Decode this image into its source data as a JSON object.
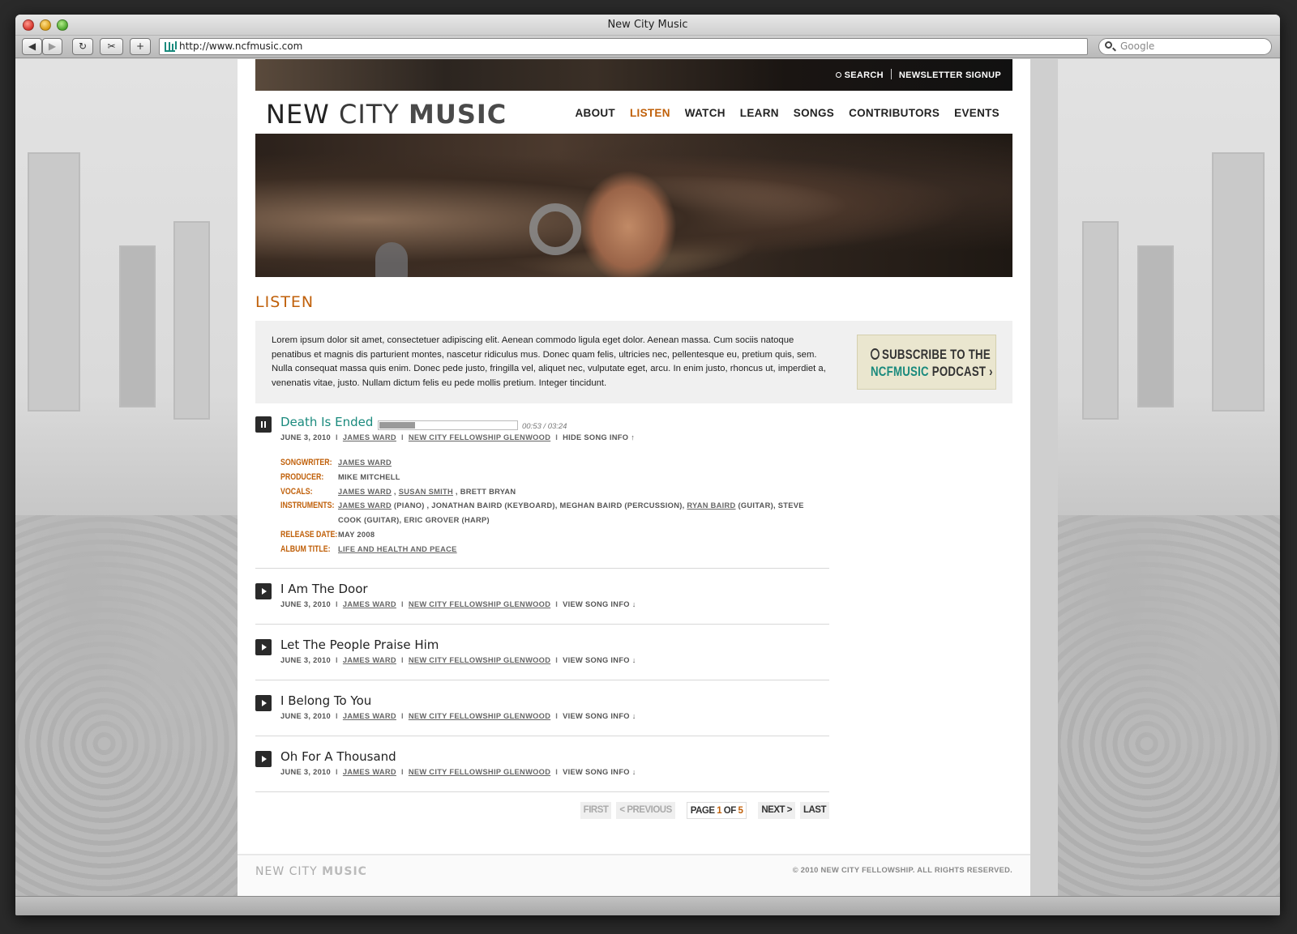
{
  "browser": {
    "window_title": "New City Music",
    "url": "http://www.ncfmusic.com",
    "search_placeholder": "Google",
    "back_icon": "◀",
    "forward_icon": "▶",
    "reload_icon": "↻",
    "add_icon": "+"
  },
  "top_links": {
    "search": "SEARCH",
    "newsletter": "NEWSLETTER SIGNUP"
  },
  "logo": {
    "part1": "NEW ",
    "part2": "CITY ",
    "part3": "MUSIC"
  },
  "nav": [
    "ABOUT",
    "LISTEN",
    "WATCH",
    "LEARN",
    "SONGS",
    "CONTRIBUTORS",
    "EVENTS"
  ],
  "nav_active": "LISTEN",
  "section_title": "LISTEN",
  "intro_text": "Lorem ipsum dolor sit amet, consectetuer adipiscing elit. Aenean commodo ligula eget dolor. Aenean massa. Cum sociis natoque penatibus et magnis dis parturient montes, nascetur ridiculus mus. Donec quam felis, ultricies nec, pellentesque eu, pretium quis, sem. Nulla consequat massa quis enim. Donec pede justo, fringilla vel, aliquet nec, vulputate eget, arcu. In enim justo, rhoncus ut, imperdiet a, venenatis vitae, justo. Nullam dictum felis eu pede mollis pretium. Integer tincidunt.",
  "podcast": {
    "line1": "SUBSCRIBE TO THE",
    "line2_teal": "NCFMUSIC",
    "line2_rest": " PODCAST",
    "arrow": "›"
  },
  "now_playing": {
    "title": "Death Is Ended",
    "time": "00:53 / 03:24",
    "progress": 0.26,
    "date": "JUNE 3, 2010",
    "artist": "JAMES WARD",
    "church": "NEW CITY FELLOWSHIP GLENWOOD",
    "toggle": "HIDE SONG INFO",
    "toggle_icon": "↑",
    "details": {
      "songwriter_label": "SONGWRITER:",
      "songwriter": "JAMES WARD",
      "producer_label": "PRODUCER:",
      "producer": "MIKE MITCHELL",
      "vocals_label": "VOCALS:",
      "vocals_1": "JAMES WARD",
      "vocals_2": "SUSAN SMITH",
      "vocals_3": "BRETT BRYAN",
      "instruments_label": "INSTRUMENTS:",
      "instruments_1": "JAMES WARD",
      "instruments_2": " (PIANO) , JONATHAN BAIRD (KEYBOARD), MEGHAN BAIRD (PERCUSSION), ",
      "instruments_3": "RYAN BAIRD",
      "instruments_4": " (GUITAR), STEVE COOK (GUITAR), ERIC GROVER (HARP)",
      "release_label": "RELEASE DATE:",
      "release": "MAY 2008",
      "album_label": "ALBUM TITLE:",
      "album": "LIFE AND HEALTH AND PEACE"
    }
  },
  "songs": [
    {
      "title": "I Am The Door",
      "date": "JUNE 3, 2010",
      "artist": "JAMES WARD",
      "church": "NEW CITY FELLOWSHIP GLENWOOD",
      "toggle": "VIEW SONG INFO",
      "toggle_icon": "↓"
    },
    {
      "title": "Let The People Praise Him",
      "date": "JUNE 3, 2010",
      "artist": "JAMES WARD",
      "church": "NEW CITY FELLOWSHIP GLENWOOD",
      "toggle": "VIEW SONG INFO",
      "toggle_icon": "↓"
    },
    {
      "title": "I Belong To You",
      "date": "JUNE 3, 2010",
      "artist": "JAMES WARD",
      "church": "NEW CITY FELLOWSHIP GLENWOOD",
      "toggle": "VIEW SONG INFO",
      "toggle_icon": "↓"
    },
    {
      "title": "Oh For A Thousand",
      "date": "JUNE 3, 2010",
      "artist": "JAMES WARD",
      "church": "NEW CITY FELLOWSHIP GLENWOOD",
      "toggle": "VIEW SONG INFO",
      "toggle_icon": "↓"
    }
  ],
  "pager": {
    "first": "FIRST",
    "previous": "< PREVIOUS",
    "page_word": "PAGE ",
    "current": "1",
    "of_word": " OF ",
    "total": "5",
    "next": "NEXT >",
    "last": "LAST"
  },
  "footer": {
    "logo_1": "NEW CITY ",
    "logo_2": "MUSIC",
    "copyright": "© 2010 NEW CITY FELLOWSHIP. ALL RIGHTS RESERVED."
  },
  "colors": {
    "accent": "#c0600a",
    "teal": "#1a8a7d"
  }
}
